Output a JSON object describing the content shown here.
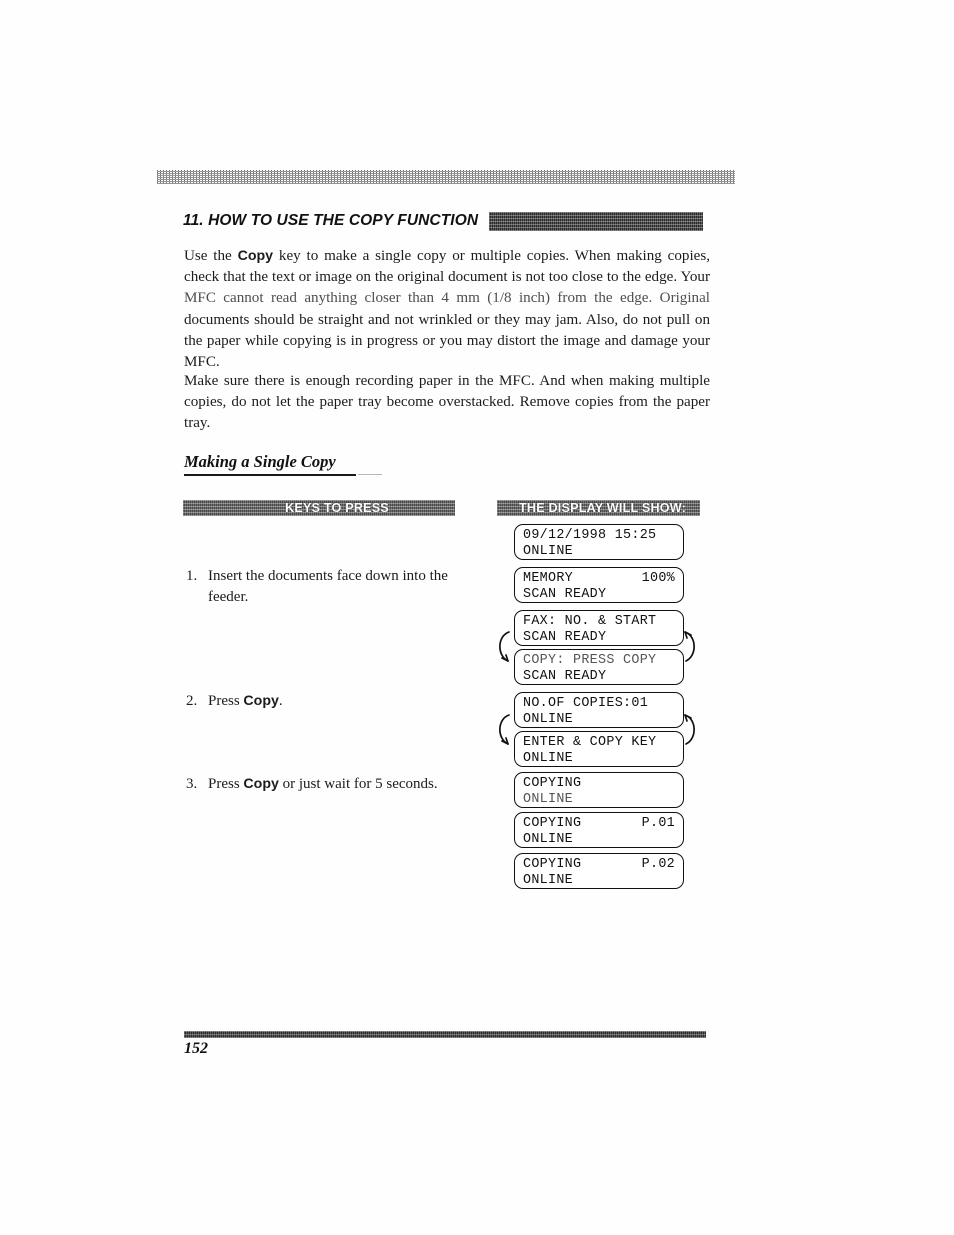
{
  "document": {
    "page_number": "152",
    "section_heading": "11. HOW TO USE THE COPY FUNCTION",
    "subheading": "Making a Single Copy"
  },
  "body": {
    "paragraph_1": {
      "line_1_a": "Use the ",
      "line_1_keyword": "Copy",
      "line_1_b": " key to make a single copy or multiple copies. When making copies, check that the text or image on the original document is not too close to the edge. Your ",
      "line_faded": "MFC cannot read anything closer than 4 mm (1/8 inch) from the edge. Original ",
      "line_rest": "documents should be straight and not wrinkled or they may jam. Also, do not pull on the paper while copying is in progress or you may distort the image and damage your MFC."
    },
    "paragraph_2": "Make sure there is enough recording paper in the MFC. And when making multiple copies, do not let the paper tray become overstacked. Remove copies from the paper tray."
  },
  "table": {
    "header_keys": "KEYS TO PRESS",
    "header_display": "THE DISPLAY WILL SHOW:",
    "steps": [
      {
        "number": "1.",
        "text_a": "Insert the documents face down into the feeder.",
        "keyword": "",
        "text_b": ""
      },
      {
        "number": "2.",
        "text_a": "Press ",
        "keyword": "Copy",
        "text_b": "."
      },
      {
        "number": "3.",
        "text_a": "Press ",
        "keyword": "Copy",
        "text_b": " or just wait for 5 seconds."
      }
    ],
    "displays": [
      {
        "line1_left": "09/12/1998 15:25",
        "line1_right": "",
        "line2_left": "ONLINE",
        "line2_right": "",
        "faint": false
      },
      {
        "line1_left": "MEMORY",
        "line1_right": "100%",
        "line2_left": "SCAN READY",
        "line2_right": "",
        "faint": false
      },
      {
        "line1_left": "FAX: NO. & START",
        "line1_right": "",
        "line2_left": "SCAN READY",
        "line2_right": "",
        "faint": false
      },
      {
        "line1_left": "COPY: PRESS COPY",
        "line1_right": "",
        "line2_left": "SCAN READY",
        "line2_right": "",
        "faint": true
      },
      {
        "line1_left": "NO.OF COPIES:01",
        "line1_right": "",
        "line2_left": "ONLINE",
        "line2_right": "",
        "faint": false
      },
      {
        "line1_left": "ENTER & COPY KEY",
        "line1_right": "",
        "line2_left": "ONLINE",
        "line2_right": "",
        "faint": false
      },
      {
        "line1_left": "COPYING",
        "line1_right": "",
        "line2_left": "ONLINE",
        "line2_right": "",
        "faint": true
      },
      {
        "line1_left": "COPYING",
        "line1_right": "P.01",
        "line2_left": "ONLINE",
        "line2_right": "",
        "faint": false
      },
      {
        "line1_left": "COPYING",
        "line1_right": "P.02",
        "line2_left": "ONLINE",
        "line2_right": "",
        "faint": false
      }
    ]
  },
  "colors": {
    "ink": "#111111",
    "paper": "#fefefe",
    "bar_dark": "#2a2a2a",
    "bar_light": "#8f8f8f"
  }
}
